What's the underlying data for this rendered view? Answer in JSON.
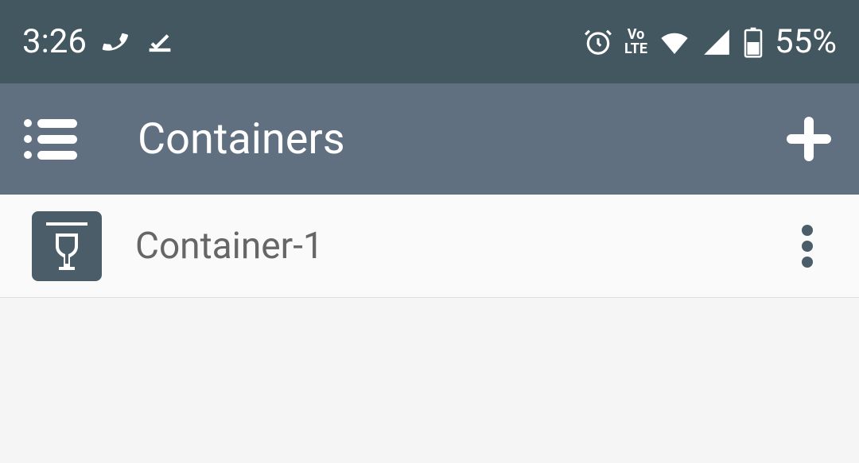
{
  "statusBar": {
    "time": "3:26",
    "batteryPercent": "55%",
    "volteLabel": "Vo\nLTE"
  },
  "appBar": {
    "title": "Containers"
  },
  "list": {
    "items": [
      {
        "label": "Container-1"
      }
    ]
  }
}
